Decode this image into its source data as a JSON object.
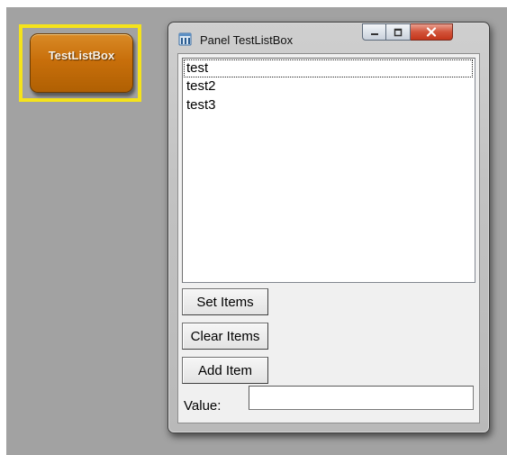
{
  "launcher": {
    "label": "TestListBox"
  },
  "window": {
    "title": "Panel TestListBox",
    "icon": "app-window-icon",
    "controls": {
      "minimize": "minimize-icon",
      "maximize": "maximize-icon",
      "close": "close-icon"
    }
  },
  "listbox": {
    "items": [
      "test",
      "test2",
      "test3"
    ],
    "focused_index": 0
  },
  "buttons": {
    "set_items": "Set Items",
    "clear_items": "Clear Items",
    "add_item": "Add Item"
  },
  "value_field": {
    "label": "Value:",
    "value": ""
  },
  "colors": {
    "launcher_orange": "#c86f0b",
    "highlight_yellow": "#f5e31b",
    "close_red": "#c4361b"
  }
}
